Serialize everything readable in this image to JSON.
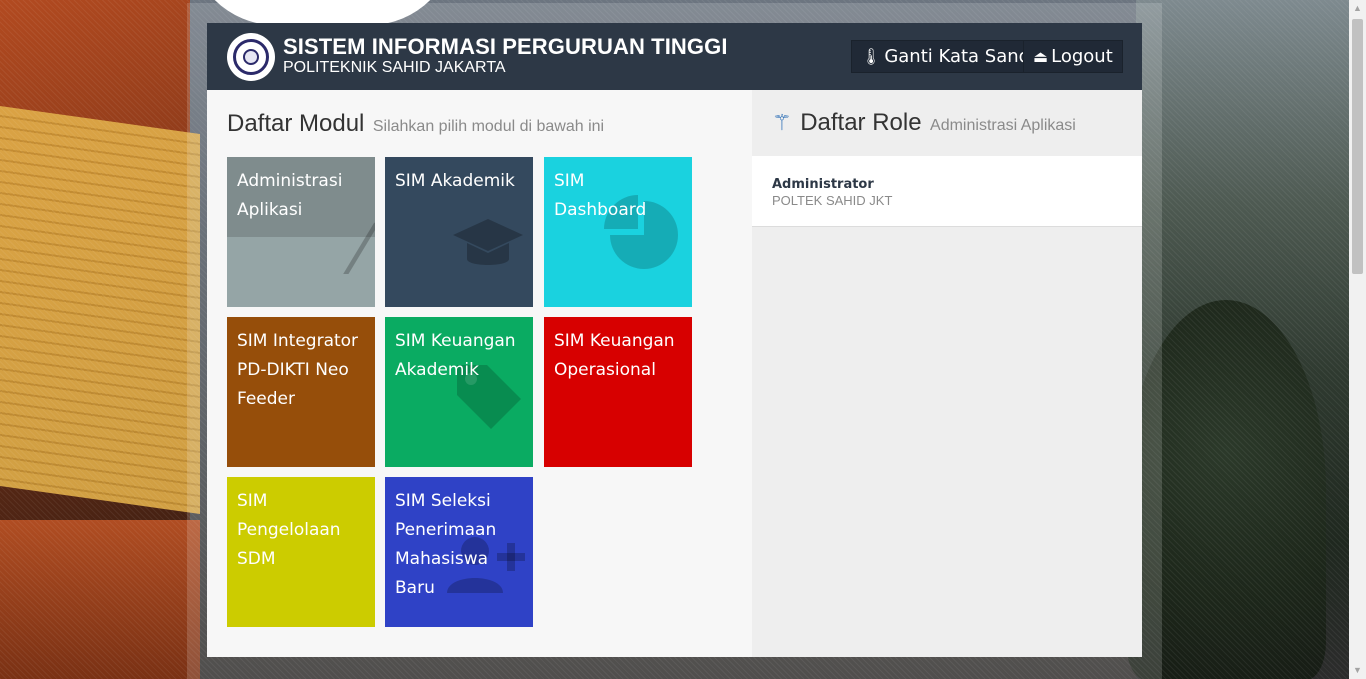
{
  "header": {
    "title": "SISTEM INFORMASI PERGURUAN TINGGI",
    "subtitle": "POLITEKNIK SAHID JAKARTA",
    "change_password_label": "Ganti Kata Sandi",
    "logout_label": "Logout"
  },
  "modules": {
    "title": "Daftar Modul",
    "subtitle": "Silahkan pilih modul di bawah ini",
    "tiles": [
      {
        "label": "Administrasi Aplikasi",
        "icon": "magic-wand-icon",
        "color": "#95a5a6"
      },
      {
        "label": "SIM Akademik",
        "icon": "graduation-cap-icon",
        "color": "#34495e"
      },
      {
        "label": "SIM Dashboard",
        "icon": "pie-chart-icon",
        "color": "#1ad2df"
      },
      {
        "label": "SIM Integrator PD-DIKTI Neo Feeder",
        "icon": "",
        "color": "#964e0a"
      },
      {
        "label": "SIM Keuangan Akademik",
        "icon": "tag-icon",
        "color": "#0aab62"
      },
      {
        "label": "SIM Keuangan Operasional",
        "icon": "",
        "color": "#d70000"
      },
      {
        "label": "SIM Pengelolaan SDM",
        "icon": "",
        "color": "#cccc00"
      },
      {
        "label": "SIM Seleksi Penerimaan Mahasiswa Baru",
        "icon": "user-plus-icon",
        "color": "#2f42c6"
      }
    ]
  },
  "roles": {
    "title": "Daftar Role",
    "subtitle": "Administrasi Aplikasi",
    "items": [
      {
        "name": "Administrator",
        "org": "POLTEK SAHID JKT"
      }
    ]
  }
}
